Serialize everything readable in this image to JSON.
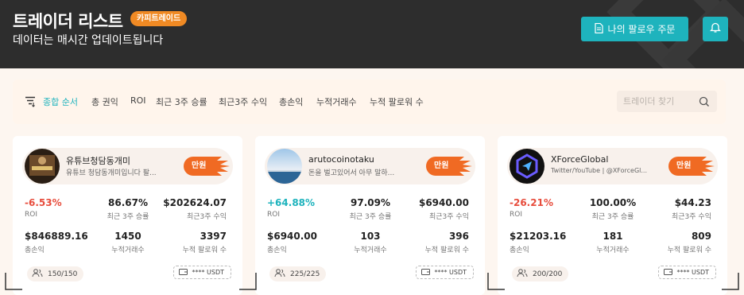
{
  "header": {
    "title": "트레이더 리스트",
    "badge": "카피트레이드",
    "subtitle": "데이터는 매시간 업데이트됩니다",
    "follow_button": "나의 팔로우 주문"
  },
  "filters": {
    "items": [
      "종합 순서",
      "총 권익",
      "ROI",
      "최근 3주 승률",
      "최근3주 수익",
      "총손익",
      "누적거래수",
      "누적 팔로워 수"
    ],
    "active_index": 0
  },
  "search": {
    "placeholder": "트레이더 찾기"
  },
  "cards": [
    {
      "name": "유튜브청담동개미",
      "bio": "유튜브 청담동개미입니다 팔...",
      "tag": "만원",
      "roi": "-6.53%",
      "roi_label": "ROI",
      "win_rate": "86.67%",
      "win_rate_label": "최근 3주 승률",
      "profit_3w": "$202624.07",
      "profit_3w_label": "최근3주 수익",
      "total_pnl": "$846889.16",
      "total_pnl_label": "총손익",
      "trades": "1450",
      "trades_label": "누적거래수",
      "followers": "3397",
      "followers_label": "누적 팔로워 수",
      "capacity": "150/150",
      "usdt": "**** USDT"
    },
    {
      "name": "arutocoinotaku",
      "bio": "돈을 벌고있어서 아무 말하...",
      "tag": "만원",
      "roi": "+64.88%",
      "roi_label": "ROI",
      "win_rate": "97.09%",
      "win_rate_label": "최근 3주 승률",
      "profit_3w": "$6940.00",
      "profit_3w_label": "최근3주 수익",
      "total_pnl": "$6940.00",
      "total_pnl_label": "총손익",
      "trades": "103",
      "trades_label": "누적거래수",
      "followers": "396",
      "followers_label": "누적 팔로워 수",
      "capacity": "225/225",
      "usdt": "**** USDT"
    },
    {
      "name": "XForceGlobal",
      "bio": "Twitter/YouTube | @XForceGl...",
      "tag": "만원",
      "roi": "-26.21%",
      "roi_label": "ROI",
      "win_rate": "100.00%",
      "win_rate_label": "최근 3주 승률",
      "profit_3w": "$44.23",
      "profit_3w_label": "최근3주 수익",
      "total_pnl": "$21203.16",
      "total_pnl_label": "총손익",
      "trades": "181",
      "trades_label": "누적거래수",
      "followers": "809",
      "followers_label": "누적 팔로워 수",
      "capacity": "200/200",
      "usdt": "**** USDT"
    }
  ],
  "colors": {
    "accent": "#1eb3bd",
    "tag": "#f06a23",
    "negative": "#e74c3c",
    "header_bg": "#2d2d2d"
  }
}
